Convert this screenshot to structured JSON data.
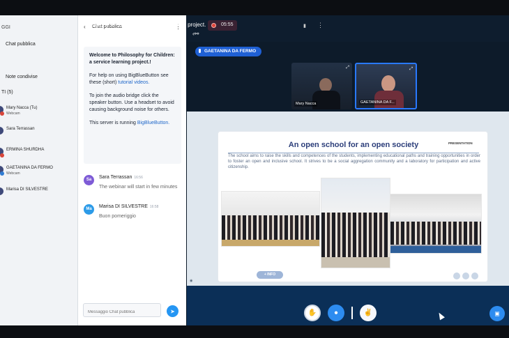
{
  "user_panel": {
    "section_label": "GGI",
    "chat_link": "Chat pubblica",
    "notes_link": "Note condivise",
    "users_header": "TI (5)",
    "users": [
      {
        "name": "Mary Nacca (Tu)",
        "sub": "Webcam"
      },
      {
        "name": "Sara Terrassan",
        "sub": ""
      },
      {
        "name": "ERMINA SHURDHA",
        "sub": ""
      },
      {
        "name": "GAETANINA DA FERMO",
        "sub": "Webcam"
      },
      {
        "name": "Marisa DI SILVESTRE",
        "sub": ""
      }
    ]
  },
  "chat": {
    "title": "Chat pubblica",
    "welcome": {
      "heading": "Welcome to Philosophy for Children: a service learning project.!",
      "help_prefix": "For help on using BigBlueButton see these (short) ",
      "help_link": "tutorial videos.",
      "audio": "To join the audio bridge click the speaker button. Use a headset to avoid causing background noise for others.",
      "server_prefix": "This server is running ",
      "server_link": "BigBlueButton."
    },
    "messages": [
      {
        "initials": "Sa",
        "author": "Sara Terrassan",
        "time": "16:56",
        "text": "The webinar will start in few minutes",
        "color": "#7e5bd6"
      },
      {
        "initials": "Ma",
        "author": "Marisa DI SILVESTRE",
        "time": "16:58",
        "text": "Buon pomeriggio",
        "color": "#2c9be8"
      }
    ],
    "input_placeholder": "Messaggio Chat pubblica"
  },
  "topbar": {
    "meeting_title": "Philosophy for Children: a service learning project.",
    "recording_time": "05:55"
  },
  "talker": "GAETANINA DA FERMO",
  "videos": [
    {
      "name": "Mary Nacca"
    },
    {
      "name": "GAETANINA DA F..."
    }
  ],
  "slide": {
    "title": "An open school for an open society",
    "tag": "PRESENTATION",
    "text": "The school aims to raise the skills and competences of the students, implementing educational paths and training opportunities in order to foster an open and inclusive school. It strives to be a social aggregation community and a laboratory for participation and active citizenship.",
    "info_label": "+ INFO"
  }
}
